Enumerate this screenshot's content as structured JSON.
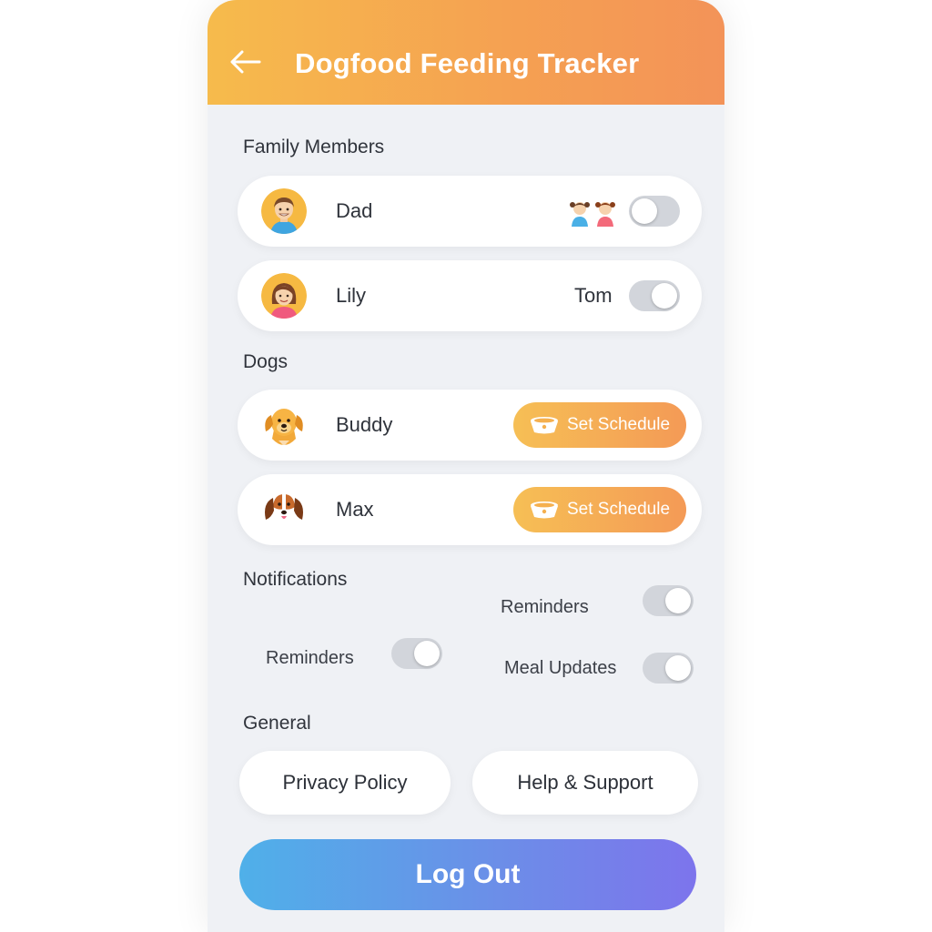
{
  "header": {
    "title": "Dogfood Feeding Tracker",
    "back_icon": "arrow-left-icon"
  },
  "family": {
    "title": "Family Members",
    "members": [
      {
        "name": "Dad",
        "avatar": "man-avatar-icon",
        "side_icons": "two-kids-icon",
        "toggle_on": false
      },
      {
        "name": "Lily",
        "avatar": "girl-avatar-icon",
        "side_text": "Tom",
        "toggle_on": true
      }
    ]
  },
  "dogs": {
    "title": "Dogs",
    "items": [
      {
        "name": "Buddy",
        "avatar": "golden-retriever-icon",
        "button_label": "Set Schedule",
        "button_icon": "dog-bowl-icon"
      },
      {
        "name": "Max",
        "avatar": "beagle-icon",
        "button_label": "Set Schedule",
        "button_icon": "dog-bowl-icon"
      }
    ]
  },
  "notifications": {
    "title": "Notifications",
    "items": [
      {
        "label": "Reminders",
        "on": true
      },
      {
        "label": "Reminders",
        "on": true
      },
      {
        "label": "Meal Updates",
        "on": true
      }
    ]
  },
  "general": {
    "title": "General",
    "privacy_label": "Privacy Policy",
    "help_label": "Help & Support"
  },
  "logout_label": "Log Out",
  "colors": {
    "header_start": "#f6bb4c",
    "header_end": "#f39358",
    "logout_start": "#4fb0e9",
    "logout_end": "#7d74ec",
    "toggle_track": "#d2d5db"
  }
}
